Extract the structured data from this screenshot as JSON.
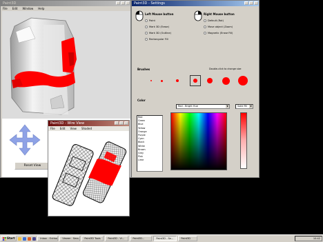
{
  "viewer": {
    "title": "Paint3D",
    "menu": [
      "File",
      "Edit",
      "Window",
      "Help"
    ],
    "move_button": "Reset View",
    "navigate_icon": "four-way-arrow-icon"
  },
  "paint_window": {
    "title": "Paint3D - Settings",
    "left_mouse": {
      "title": "Left Mouse button",
      "options": [
        "Paint",
        "Mark 3D (Erase)",
        "Mark 3D (Outline)",
        "Rectangular Fill"
      ]
    },
    "right_mouse": {
      "title": "Right Mouse button",
      "options": [
        "Default (Rot)",
        "Move object (Zoom)",
        "Magnetic (Erase Fill)"
      ]
    },
    "brushes_label": "Brushes",
    "brushes_hint": "Double-click to change size",
    "brush_count": 7,
    "selected_brush_index": 3,
    "color_label": "Color",
    "color_names": [
      "Red",
      "Green",
      "Blue",
      "Yellow",
      "Orange",
      "Purple",
      "Cyan",
      "Black",
      "White",
      "Brown",
      "Grey",
      "Pink",
      "Lime"
    ],
    "palette_dropdown": "Red - Bright Hue",
    "mode_dropdown": "Solid Fill"
  },
  "overlay": {
    "title": "Paint3D - Wire View",
    "menu": [
      "File",
      "Edit",
      "View",
      "Shaded"
    ]
  },
  "taskbar": {
    "start_label": "Start",
    "tasks": [
      "Inbox - Outlook",
      "Viewer - Sess...",
      "Paint3D Tools",
      "Paint3D - Vi...",
      "Paint3D...",
      "Paint3D - Se...",
      "Paint3D"
    ],
    "clock": "10:42"
  },
  "colors": {
    "paint_red": "#ff0000",
    "title_blue": "#0a246a",
    "arrow_blue": "#8ea2e6"
  }
}
